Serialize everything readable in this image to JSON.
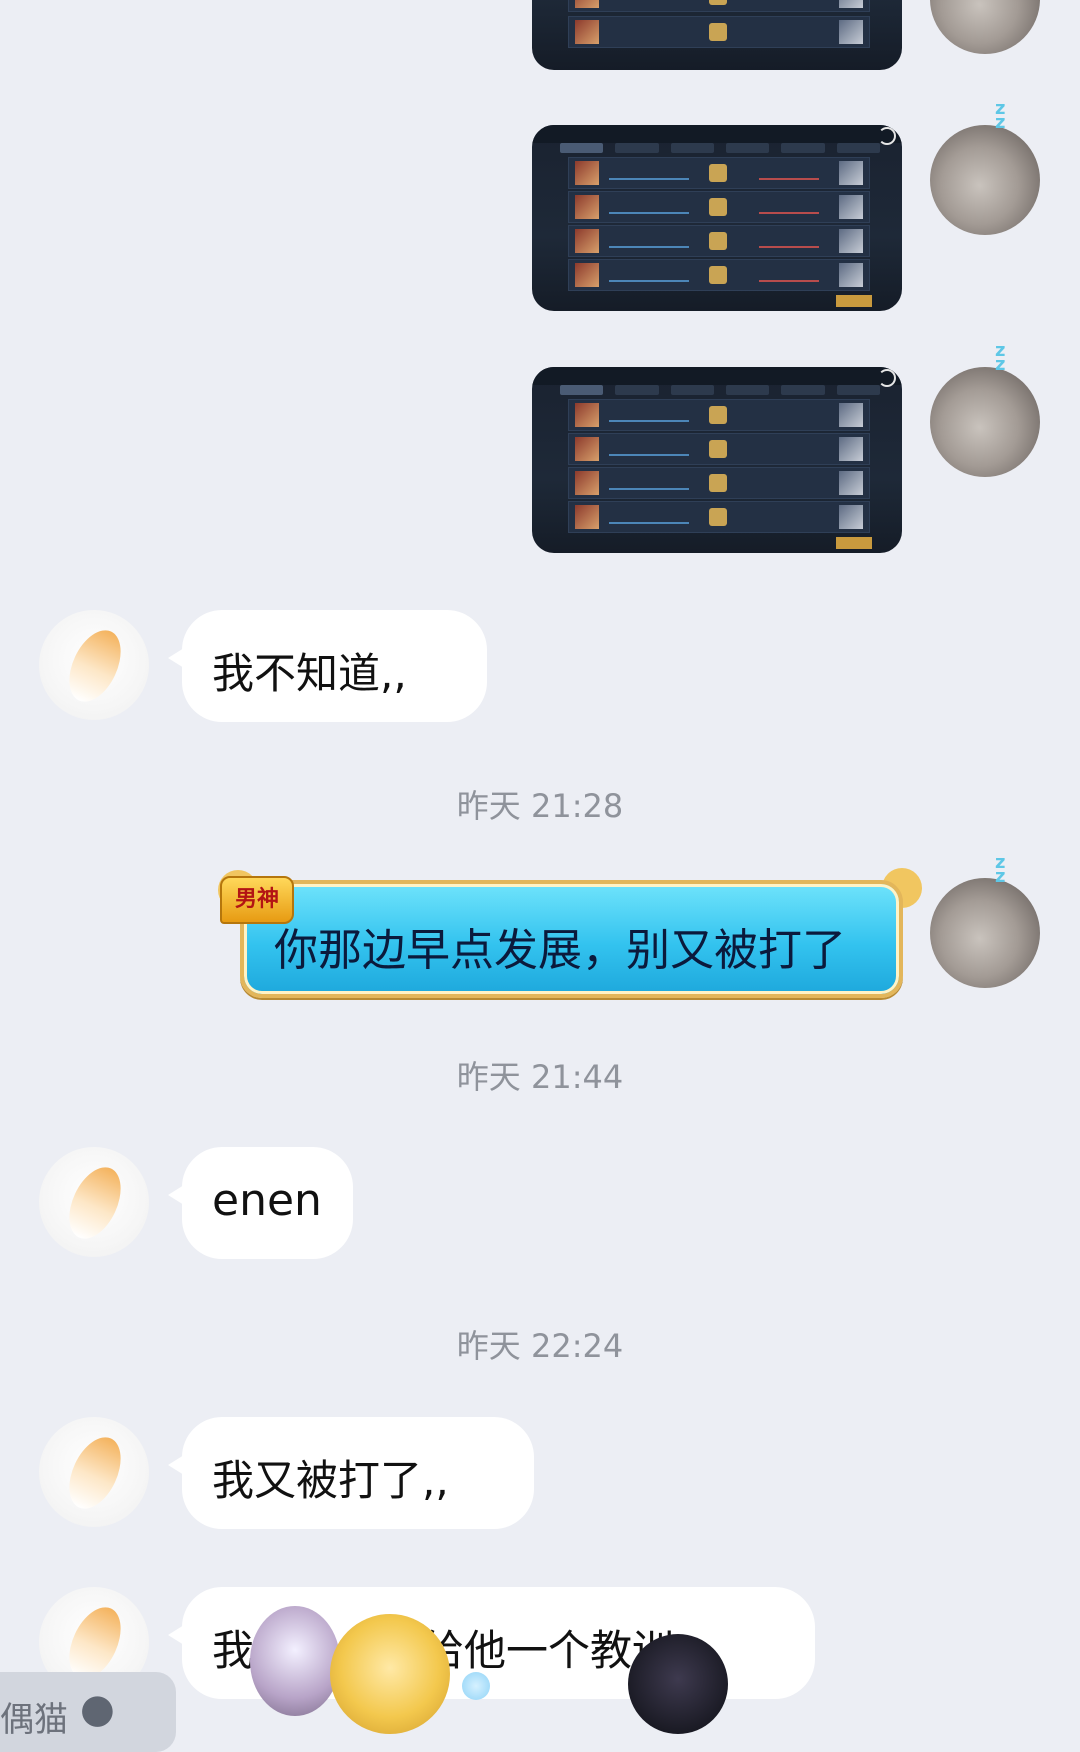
{
  "messages": {
    "m1_text": "我不知道,,",
    "m2_text": "你那边早点发展，别又被打了",
    "m2_badge": "男神",
    "m3_text": "enen",
    "m4_text": "我又被打了,,",
    "m5_text": "我想找个人给他一个教训,,"
  },
  "timestamps": {
    "t1": "昨天 21:28",
    "t2": "昨天 21:44",
    "t3": "昨天 22:24"
  },
  "overlay": {
    "pet_label": "偶猫"
  },
  "colors": {
    "background": "#eceef4",
    "bubble": "#ffffff",
    "fancy_bubble": "#33c3ef",
    "timestamp": "#8f939b"
  }
}
